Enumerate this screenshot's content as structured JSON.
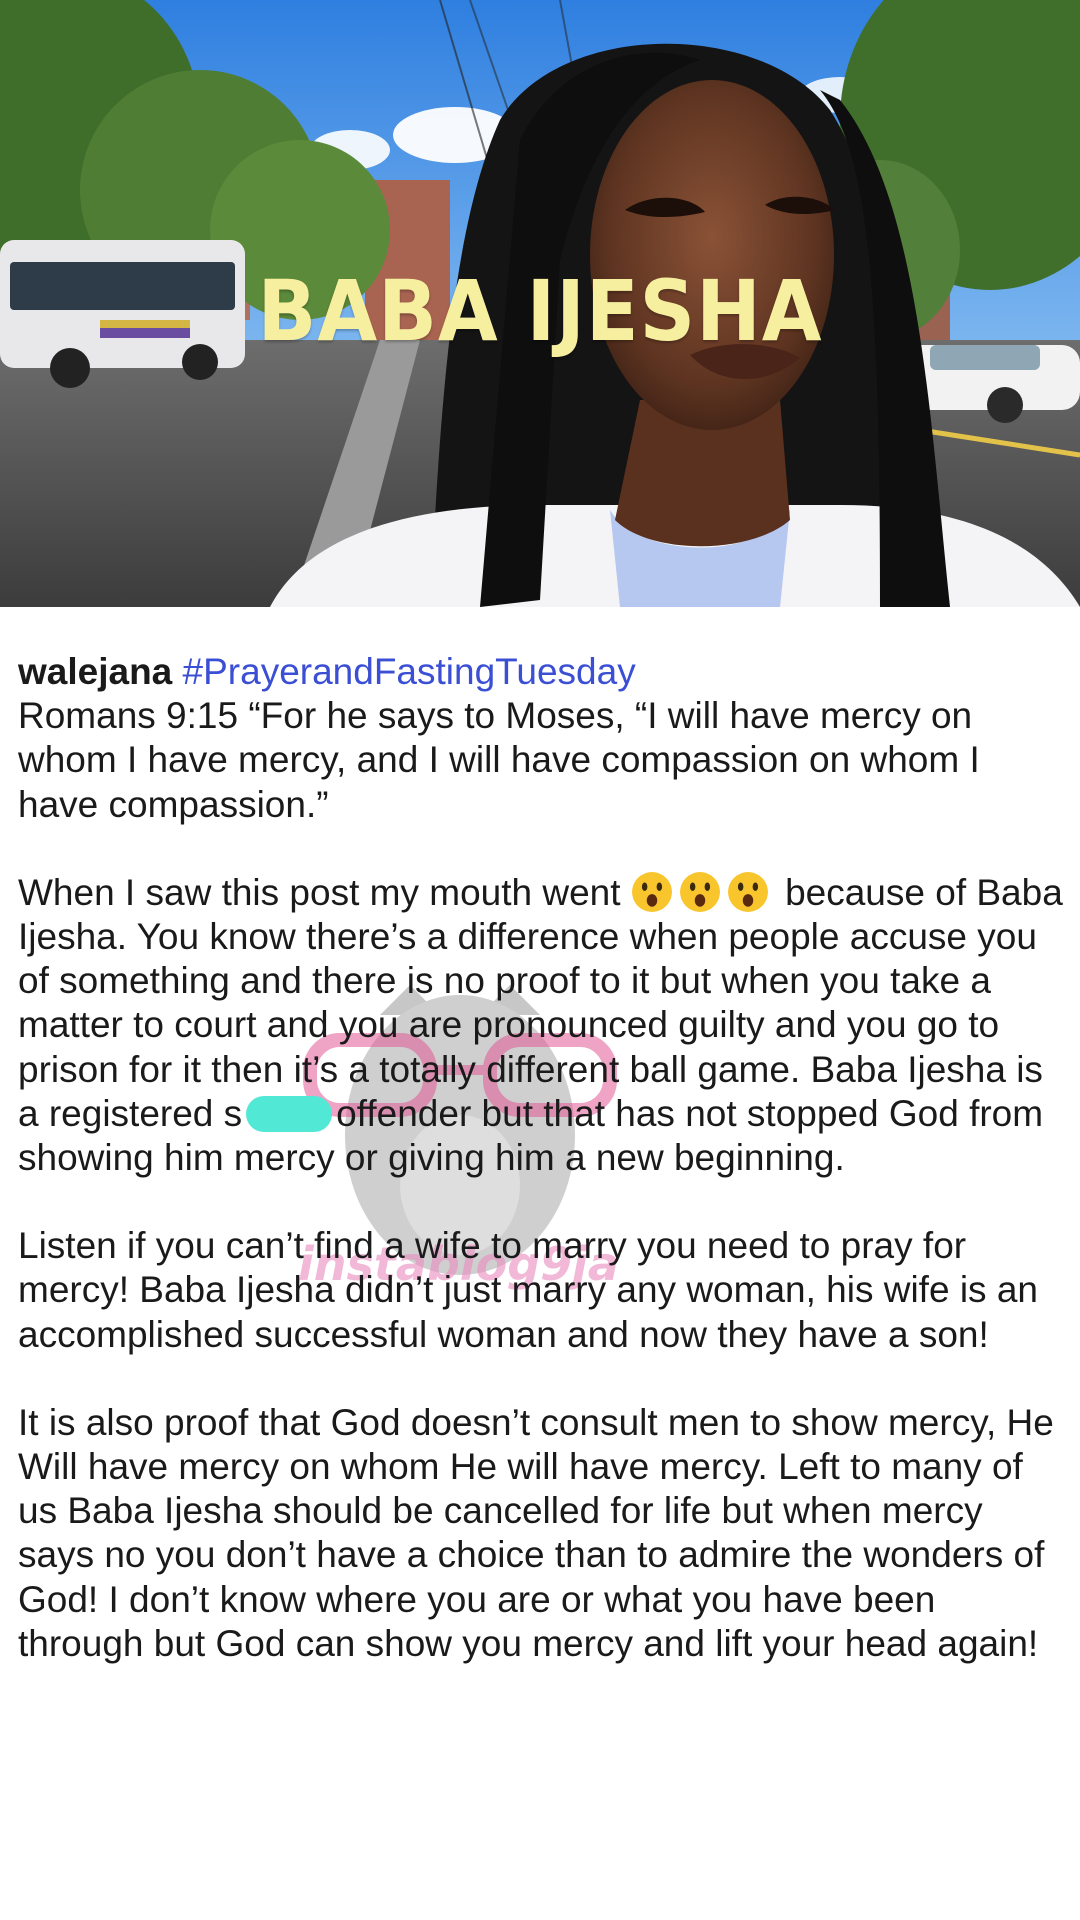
{
  "hero": {
    "title": "BABA IJESHA"
  },
  "post": {
    "username": "walejana",
    "hashtag": "#PrayerandFastingTuesday",
    "verse": "Romans 9:15 “For he says to Moses, “I will have mercy on whom I have mercy, and I will have compassion on whom I have compassion.”",
    "para1_start": "When I saw this post my mouth went",
    "emoji_name": "astonished-face-emoji",
    "para1_mid": "because of Baba Ijesha. You know there’s a difference when people accuse you of something and there is no proof to it but when you take a matter to court and you are pronounced guilty and you go to prison for it then it’s a totally different ball game. Baba Ijesha is a registered s",
    "para1_end": "offender but that has not stopped God from showing him mercy or giving him a new beginning.",
    "para2": "Listen if you can’t find a wife to marry you need to pray for mercy! Baba Ijesha didn’t just marry any woman, his wife is an accomplished successful woman and now they have a son!",
    "para3": "It is also proof that God doesn’t consult men to show mercy, He Will have mercy on whom He will have mercy. Left to many of us Baba Ijesha should be cancelled for life but when mercy says no you don’t have a choice than to admire the wonders of God! I don’t know where you are or what you have been through but God can show you mercy and lift your head again!"
  },
  "watermark": {
    "text": "instablog9ja"
  },
  "colors": {
    "hashtag": "#3b4fd4",
    "title": "#f7efa0",
    "censor": "#52e8d6",
    "watermark": "#e88cbe"
  }
}
